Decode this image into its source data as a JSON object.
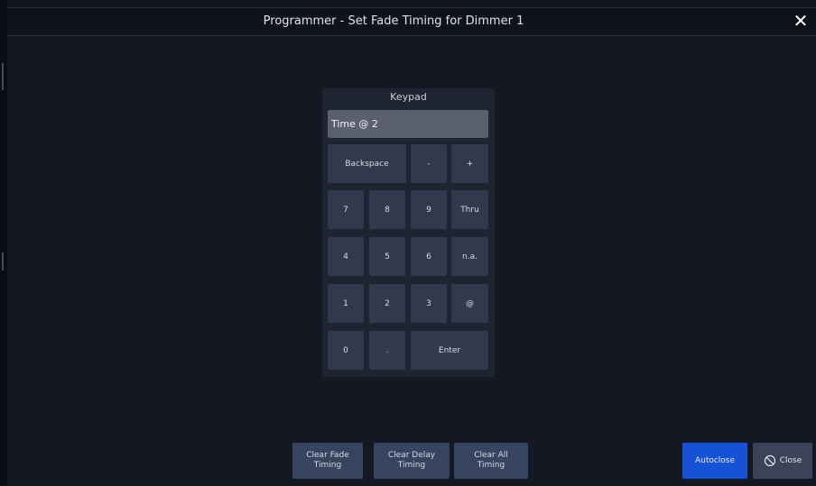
{
  "window": {
    "title": "Programmer - Set Fade Timing for Dimmer 1",
    "close_icon": "close-icon"
  },
  "keypad": {
    "title": "Keypad",
    "display_value": "Time @ 2",
    "keys": {
      "backspace": "Backspace",
      "minus": "-",
      "plus": "+",
      "k7": "7",
      "k8": "8",
      "k9": "9",
      "thru": "Thru",
      "k4": "4",
      "k5": "5",
      "k6": "6",
      "na": "n.a.",
      "k1": "1",
      "k2": "2",
      "k3": "3",
      "at": "@",
      "k0": "0",
      "dot": ".",
      "enter": "Enter"
    }
  },
  "footer": {
    "clear_fade_line1": "Clear Fade",
    "clear_fade_line2": "Timing",
    "clear_delay_line1": "Clear Delay",
    "clear_delay_line2": "Timing",
    "clear_all_line1": "Clear All",
    "clear_all_line2": "Timing",
    "autoclose": "Autoclose",
    "close": "Close"
  },
  "colors": {
    "background": "#131823",
    "keypad": "#1e2430",
    "key": "#313a4c",
    "accent_blue": "#1652d6"
  }
}
